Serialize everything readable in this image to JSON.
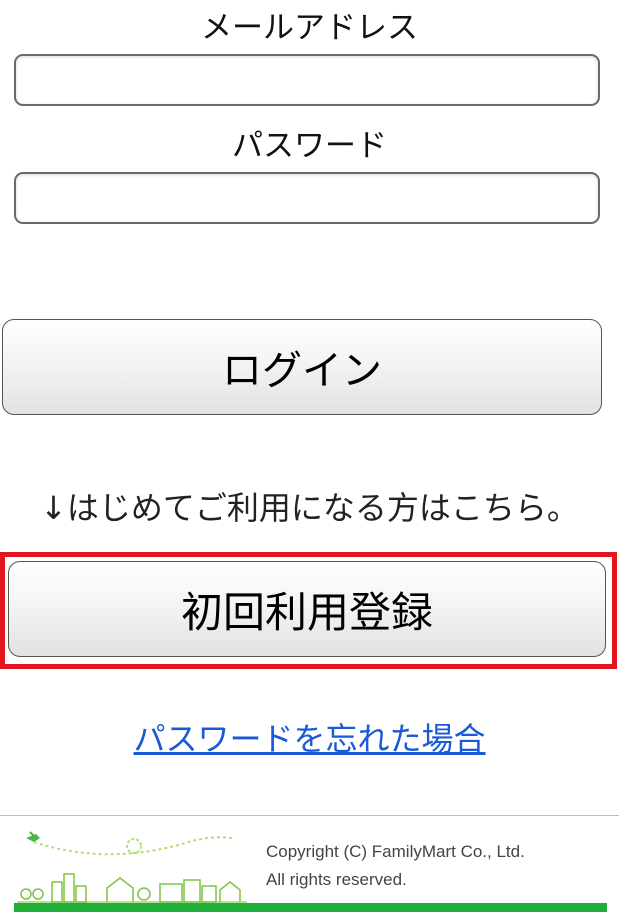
{
  "form": {
    "email_label": "メールアドレス",
    "email_value": "",
    "password_label": "パスワード",
    "password_value": "",
    "login_label": "ログイン"
  },
  "registration": {
    "notice": "↓はじめてご利用になる方はこちら。",
    "register_label": "初回利用登録",
    "highlight_color": "#e3151f"
  },
  "forgot_password_link": "パスワードを忘れた場合",
  "footer": {
    "copyright_line1": "Copyright (C) FamilyMart Co., Ltd.",
    "copyright_line2": "All rights reserved.",
    "bar_color": "#1fae3a",
    "illustration_icon": "town-illustration-icon"
  }
}
